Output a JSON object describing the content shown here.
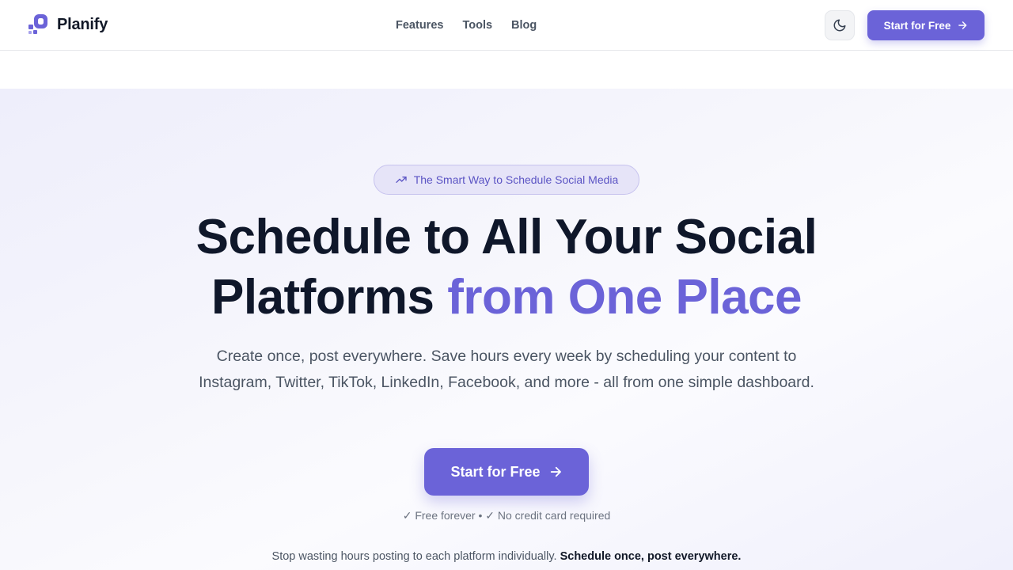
{
  "brand": {
    "name": "Planify",
    "color": "#6b63d8"
  },
  "nav": {
    "items": [
      {
        "label": "Features"
      },
      {
        "label": "Tools"
      },
      {
        "label": "Blog"
      }
    ]
  },
  "header": {
    "theme_toggle_icon": "moon-icon",
    "cta_label": "Start for Free"
  },
  "hero": {
    "badge_text": "The Smart Way to Schedule Social Media",
    "badge_icon": "trending-up-icon",
    "headline_line1": "Schedule to All Your Social",
    "headline_prefix": "Platforms ",
    "headline_accent": "from One Place",
    "subtext": "Create once, post everywhere. Save hours every week by scheduling your content to Instagram, Twitter, TikTok, LinkedIn, Facebook, and more - all from one simple dashboard.",
    "cta_label": "Start for Free",
    "assurance": "✓ Free forever • ✓ No credit card required",
    "bottom_prefix": "Stop wasting hours posting to each platform individually. ",
    "bottom_bold": "Schedule once, post everywhere."
  }
}
